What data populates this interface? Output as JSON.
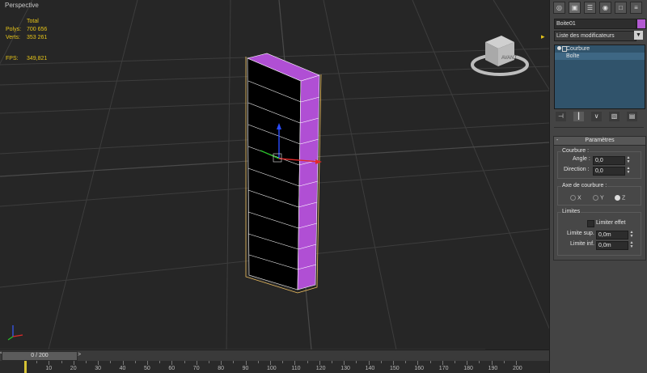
{
  "viewport": {
    "label": "Perspective",
    "stats": {
      "header": "Total",
      "rows": [
        {
          "key": "Polys:",
          "value": "700 656"
        },
        {
          "key": "Verts:",
          "value": "353 261"
        }
      ],
      "fps_key": "FPS:",
      "fps_value": "349,821"
    },
    "viewcube_label": "AVANT"
  },
  "panel": {
    "tabs": [
      "create-icon",
      "modify-icon",
      "hierarchy-icon",
      "motion-icon",
      "display-icon",
      "utilities-icon"
    ],
    "object_name": "Boite01",
    "object_color": "#b35ad2",
    "modifier_list": "Liste des modificateurs",
    "stack": [
      {
        "label": "Courbure",
        "selected": true
      },
      {
        "label": "Boîte",
        "selected": false
      }
    ],
    "rollout": {
      "title": "Paramètres",
      "courbure": {
        "group_label": "Courbure :",
        "angle_label": "Angle :",
        "angle_value": "0,0",
        "direction_label": "Direction :",
        "direction_value": "0,0"
      },
      "axe": {
        "group_label": "Axe de courbure :",
        "options": [
          "X",
          "Y",
          "Z"
        ],
        "selected": "Z"
      },
      "limites": {
        "group_label": "Limites",
        "checkbox_label": "Limiter effet",
        "sup_label": "Limite sup. :",
        "sup_value": "0,0m",
        "inf_label": "Limite inf. :",
        "inf_value": "0,0m"
      }
    }
  },
  "timeline": {
    "frame_text": "0 / 200",
    "ticks": [
      "10",
      "20",
      "30",
      "40",
      "50",
      "60",
      "70",
      "80",
      "90",
      "100",
      "110",
      "120",
      "130",
      "140",
      "150",
      "160",
      "170",
      "180",
      "190",
      "200"
    ]
  }
}
